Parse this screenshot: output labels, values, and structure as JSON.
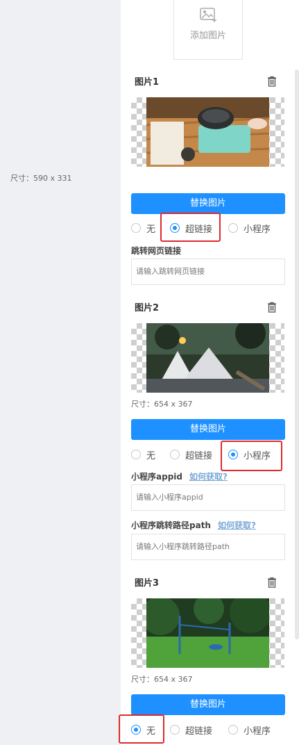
{
  "add_image": {
    "label": "添加图片"
  },
  "images": [
    {
      "title": "图片1",
      "size": "尺寸：590 x 331",
      "replace_label": "替换图片",
      "link_options": [
        "无",
        "超链接",
        "小程序"
      ],
      "selected": "超链接",
      "web_link": {
        "label": "跳转网页链接",
        "placeholder": "请输入跳转网页链接"
      }
    },
    {
      "title": "图片2",
      "size": "尺寸：654 x 367",
      "replace_label": "替换图片",
      "link_options": [
        "无",
        "超链接",
        "小程序"
      ],
      "selected": "小程序",
      "appid": {
        "label": "小程序appid",
        "help_link": "如何获取?",
        "placeholder": "请输入小程序appid"
      },
      "path": {
        "label": "小程序跳转路径path",
        "help_link": "如何获取?",
        "placeholder": "请输入小程序跳转路径path"
      }
    },
    {
      "title": "图片3",
      "size": "尺寸：654 x 367",
      "replace_label": "替换图片",
      "link_options": [
        "无",
        "超链接",
        "小程序"
      ],
      "selected": "无"
    }
  ],
  "colors": {
    "primary": "#1e90ff",
    "highlight": "#e0292c",
    "background": "#eef0f3"
  }
}
